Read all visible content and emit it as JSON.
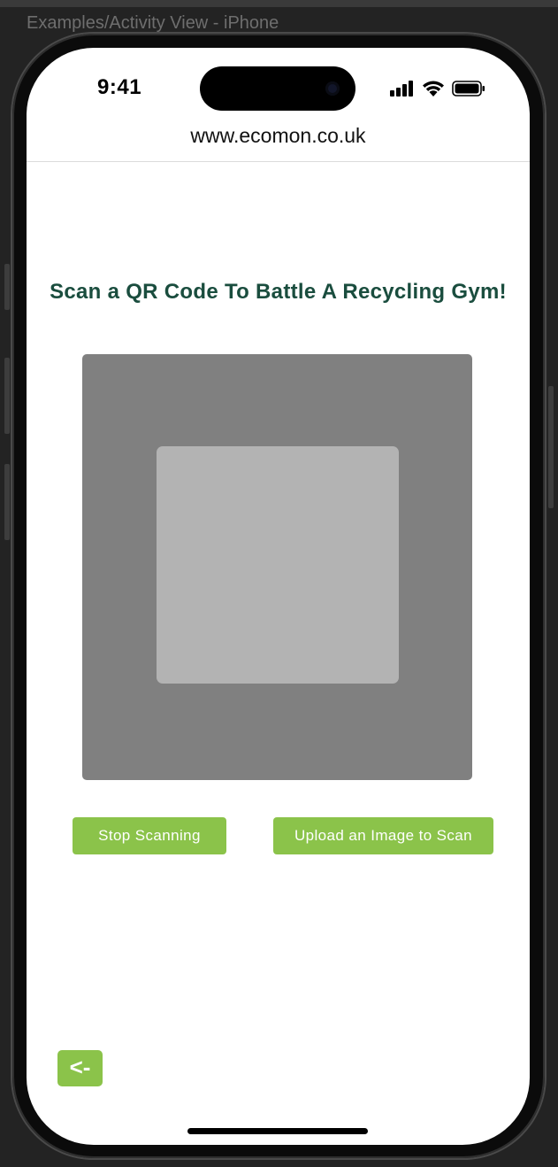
{
  "window": {
    "title": "Examples/Activity View - iPhone"
  },
  "status_bar": {
    "time": "9:41",
    "icons": [
      "cellular-signal-icon",
      "wifi-icon",
      "battery-icon"
    ]
  },
  "browser": {
    "url": "www.ecomon.co.uk"
  },
  "page": {
    "title": "Scan a QR Code To Battle A Recycling Gym!"
  },
  "actions": {
    "stop_label": "Stop Scanning",
    "upload_label": "Upload an Image to Scan",
    "back_label": "<-"
  },
  "colors": {
    "title": "#1a4d3e",
    "button": "#8bc34a",
    "scanner_background": "#808080",
    "scan_region": "#b3b3b3"
  }
}
